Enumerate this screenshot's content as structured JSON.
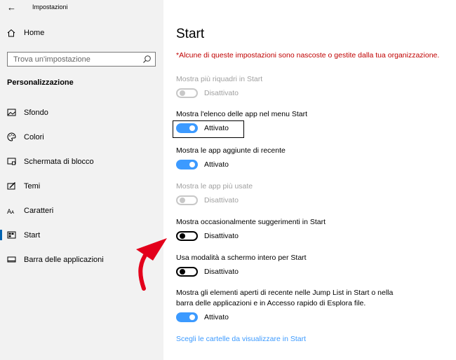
{
  "window": {
    "title": "Impostazioni",
    "back_label": "←"
  },
  "sidebar": {
    "home_label": "Home",
    "search": {
      "placeholder": "Trova un'impostazione"
    },
    "section_title": "Personalizzazione",
    "items": [
      {
        "label": "Sfondo",
        "icon": "image-icon",
        "active": false
      },
      {
        "label": "Colori",
        "icon": "palette-icon",
        "active": false
      },
      {
        "label": "Schermata di blocco",
        "icon": "lock-screen-icon",
        "active": false
      },
      {
        "label": "Temi",
        "icon": "brush-icon",
        "active": false
      },
      {
        "label": "Caratteri",
        "icon": "font-icon",
        "active": false
      },
      {
        "label": "Start",
        "icon": "start-icon",
        "active": true
      },
      {
        "label": "Barra delle applicazioni",
        "icon": "taskbar-icon",
        "active": false
      }
    ]
  },
  "main": {
    "title": "Start",
    "warning": "*Alcune di queste impostazioni sono nascoste o gestite dalla tua organizzazione.",
    "settings": [
      {
        "label": "Mostra più riquadri in Start",
        "state": "Disattivato",
        "on": false,
        "disabled": true
      },
      {
        "label": "Mostra l'elenco delle app nel menu Start",
        "state": "Attivato",
        "on": true,
        "disabled": false
      },
      {
        "label": "Mostra le app aggiunte di recente",
        "state": "Attivato",
        "on": true,
        "disabled": false
      },
      {
        "label": "Mostra le app più usate",
        "state": "Disattivato",
        "on": false,
        "disabled": true
      },
      {
        "label": "Mostra occasionalmente suggerimenti in Start",
        "state": "Disattivato",
        "on": false,
        "disabled": false
      },
      {
        "label": "Usa modalità a schermo intero per Start",
        "state": "Disattivato",
        "on": false,
        "disabled": false
      },
      {
        "label_line1": "Mostra gli elementi aperti di recente nelle Jump List in Start o nella",
        "label_line2": "barra delle applicazioni e in Accesso rapido di Esplora file.",
        "state": "Attivato",
        "on": true,
        "disabled": false
      }
    ],
    "link": "Scegli le cartelle da visualizzare in Start"
  },
  "colors": {
    "accent": "#3c9aff",
    "warning": "#c00000",
    "annotation_arrow": "#e3001b"
  }
}
